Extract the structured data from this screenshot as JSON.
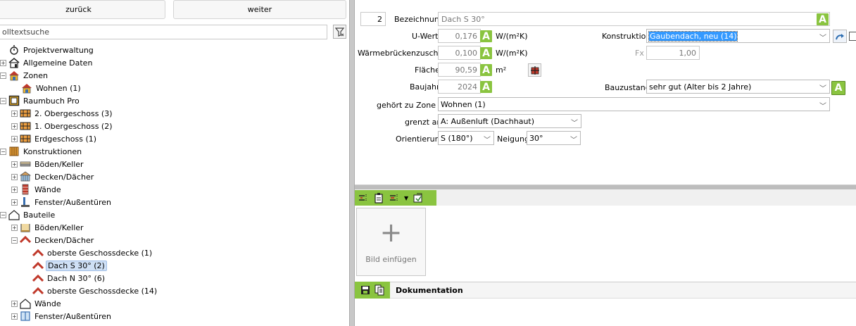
{
  "nav": {
    "back": "zurück",
    "forward": "weiter"
  },
  "search": {
    "placeholder": "olltextsuche"
  },
  "tree": {
    "projekt": "Projektverwaltung",
    "allgemein": "Allgemeine Daten",
    "zonen": "Zonen",
    "wohnen": "Wohnen (1)",
    "raumbuch": "Raumbuch Pro",
    "og2": "2. Obergeschoss (3)",
    "og1": "1. Obergeschoss (2)",
    "eg": "Erdgeschoss (1)",
    "konstruktionen": "Konstruktionen",
    "k_boeden": "Böden/Keller",
    "k_decken": "Decken/Dächer",
    "k_waende": "Wände",
    "k_fenster": "Fenster/Außentüren",
    "bauteile": "Bauteile",
    "b_boeden": "Böden/Keller",
    "b_decken": "Decken/Dächer",
    "ogd1": "oberste Geschossdecke (1)",
    "dachS": "Dach S 30° (2)",
    "dachN": "Dach N 30° (6)",
    "ogd14": "oberste Geschossdecke (14)",
    "b_waende": "Wände",
    "b_fenster": "Fenster/Außentüren"
  },
  "form": {
    "nr": "2",
    "bezeichnung_label": "Bezeichnung",
    "bezeichnung_value": "Dach S 30°",
    "uwert_label": "U-Wert",
    "uwert_value": "0,176",
    "uwert_unit": "W/(m²K)",
    "wbz_label": "Wärmebrückenzuschlag",
    "wbz_value": "0,100",
    "wbz_unit": "W/(m²K)",
    "flaeche_label": "Fläche",
    "flaeche_value": "90,59",
    "flaeche_unit": "m²",
    "baujahr_label": "Baujahr",
    "baujahr_value": "2024",
    "konstruktion_label": "Konstruktion",
    "konstruktion_value": "Gaubendach, neu (14)",
    "fx_label": "Fx",
    "fx_value": "1,00",
    "bauzustand_label": "Bauzustand",
    "bauzustand_value": "sehr gut (Alter bis 2 Jahre)",
    "zone_label": "gehört zu Zone",
    "zone_value": "Wohnen (1)",
    "grenzt_label": "grenzt an",
    "grenzt_value": "A: Außenluft (Dachhaut)",
    "orient_label": "Orientierung",
    "orient_value": "S (180°)",
    "neigung_label": "Neigung",
    "neigung_value": "30°",
    "a_badge": "A"
  },
  "images": {
    "add_label": "Bild einfügen",
    "plus": "+"
  },
  "doc": {
    "title": "Dokumentation"
  },
  "colors": {
    "accent": "#8ac440",
    "selection": "#cfe0f5",
    "konstruktion_highlight": "#3399ff"
  }
}
